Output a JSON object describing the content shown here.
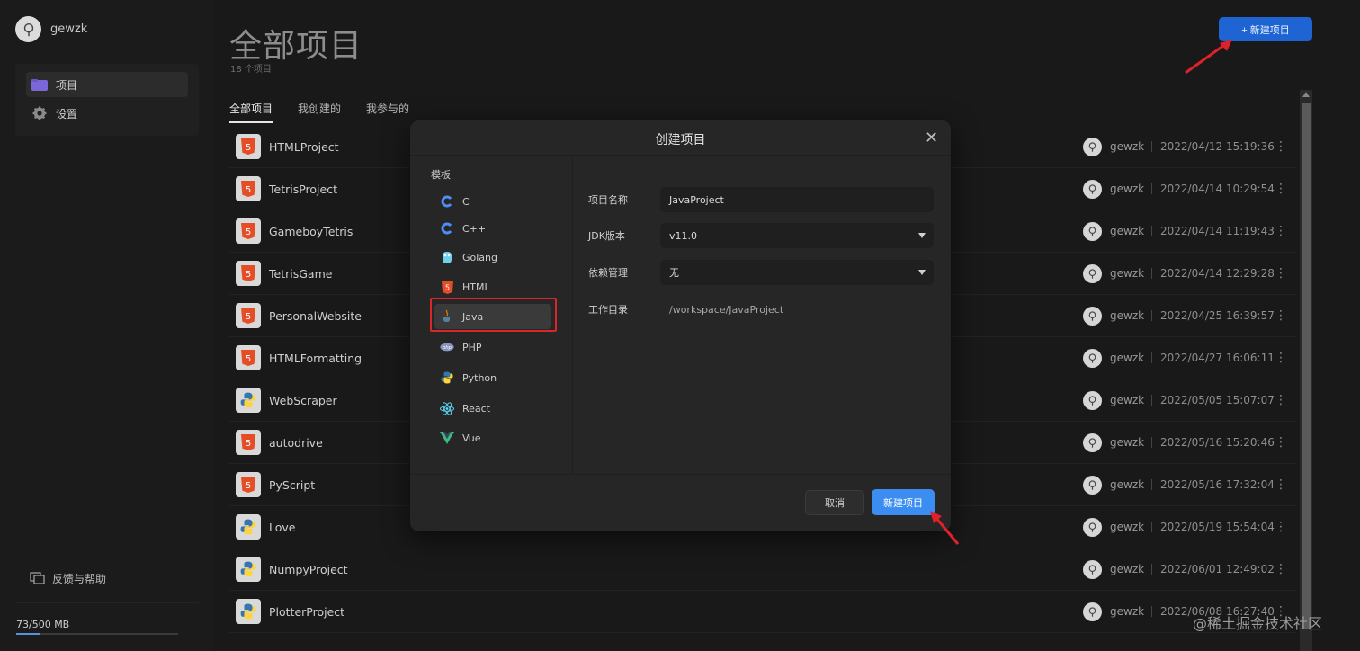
{
  "user": {
    "name": "gewzk"
  },
  "sidebar": {
    "items": [
      {
        "label": "项目",
        "icon": "folder-icon"
      },
      {
        "label": "设置",
        "icon": "gear-icon"
      }
    ],
    "feedback": "反馈与帮助",
    "storage": {
      "text": "73/500 MB",
      "used": 73,
      "total": 500
    }
  },
  "header": {
    "title": "全部项目",
    "count": "18 个项目",
    "new_button": "+ 新建项目"
  },
  "tabs": [
    "全部项目",
    "我创建的",
    "我参与的"
  ],
  "projects": [
    {
      "name": "HTMLProject",
      "type": "html",
      "owner": "gewzk",
      "date": "2022/04/12 15:19:36"
    },
    {
      "name": "TetrisProject",
      "type": "html",
      "owner": "gewzk",
      "date": "2022/04/14 10:29:54"
    },
    {
      "name": "GameboyTetris",
      "type": "html",
      "owner": "gewzk",
      "date": "2022/04/14 11:19:43"
    },
    {
      "name": "TetrisGame",
      "type": "html",
      "owner": "gewzk",
      "date": "2022/04/14 12:29:28"
    },
    {
      "name": "PersonalWebsite",
      "type": "html",
      "owner": "gewzk",
      "date": "2022/04/25 16:39:57"
    },
    {
      "name": "HTMLFormatting",
      "type": "html",
      "owner": "gewzk",
      "date": "2022/04/27 16:06:11"
    },
    {
      "name": "WebScraper",
      "type": "python",
      "owner": "gewzk",
      "date": "2022/05/05 15:07:07"
    },
    {
      "name": "autodrive",
      "type": "html",
      "owner": "gewzk",
      "date": "2022/05/16 15:20:46"
    },
    {
      "name": "PyScript",
      "type": "html",
      "owner": "gewzk",
      "date": "2022/05/16 17:32:04"
    },
    {
      "name": "Love",
      "type": "python",
      "owner": "gewzk",
      "date": "2022/05/19 15:54:04"
    },
    {
      "name": "NumpyProject",
      "type": "python",
      "owner": "gewzk",
      "date": "2022/06/01 12:49:02"
    },
    {
      "name": "PlotterProject",
      "type": "python",
      "owner": "gewzk",
      "date": "2022/06/08 16:27:40"
    }
  ],
  "modal": {
    "title": "创建项目",
    "template_label": "模板",
    "templates": [
      "C",
      "C++",
      "Golang",
      "HTML",
      "Java",
      "PHP",
      "Python",
      "React",
      "Vue"
    ],
    "selected_template": "Java",
    "fields": {
      "name_label": "项目名称",
      "name_value": "JavaProject",
      "jdk_label": "JDK版本",
      "jdk_value": "v11.0",
      "dep_label": "依赖管理",
      "dep_value": "无",
      "dir_label": "工作目录",
      "dir_value": "/workspace/JavaProject"
    },
    "cancel": "取消",
    "create": "新建项目"
  },
  "watermark": "@稀土掘金技术社区",
  "colors": {
    "accent": "#1e64d2",
    "create_button": "#3b8df2",
    "highlight": "#d8262a",
    "arrow": "#e0202a"
  }
}
